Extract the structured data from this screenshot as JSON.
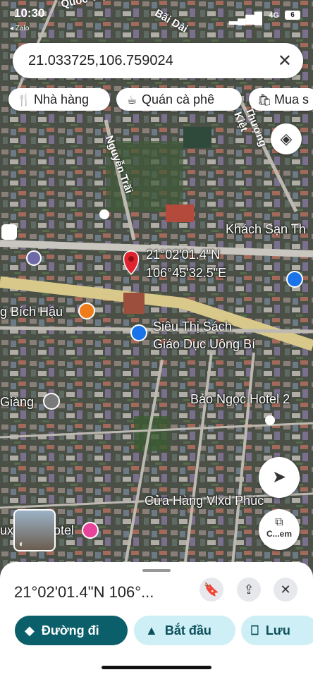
{
  "status_bar": {
    "time": "10:30",
    "back_app": "◂ Zalo",
    "network": "4G",
    "battery": "6"
  },
  "search": {
    "query": "21.033725,106.759024",
    "clear_icon": "close-icon"
  },
  "chips": [
    {
      "icon": "restaurant-icon",
      "label": "Nhà hàng"
    },
    {
      "icon": "coffee-icon",
      "label": "Quán cà phê"
    },
    {
      "icon": "shopping-bag-icon",
      "label": "Mua s"
    }
  ],
  "map": {
    "pin_label_line1": "21°02'01.4\"N",
    "pin_label_line2": "106°45'32.5\"E",
    "places": [
      "Khách Sạn Th",
      "g Bích Hậu",
      "Siêu Thị Sách",
      "Giáo Dục Uông Bí",
      "Bảo Ngọc Hotel 2",
      "Giàng",
      "Cửa Hàng Vlxd Phúc",
      "ux",
      "otel"
    ],
    "streets": [
      "Nguyễn Trãi",
      "Thượng Kiệt",
      "Bãi Dài",
      "Quốc Việt"
    ]
  },
  "street_view_label": "C...em",
  "sheet": {
    "title": "21°02'01.4\"N 106°...",
    "directions_label": "Đường đi",
    "start_label": "Bắt đầu",
    "save_label": "Lưu"
  },
  "colors": {
    "accent": "#0b5f6b",
    "chip_light": "#cdeff5",
    "pin": "#e0242f"
  }
}
